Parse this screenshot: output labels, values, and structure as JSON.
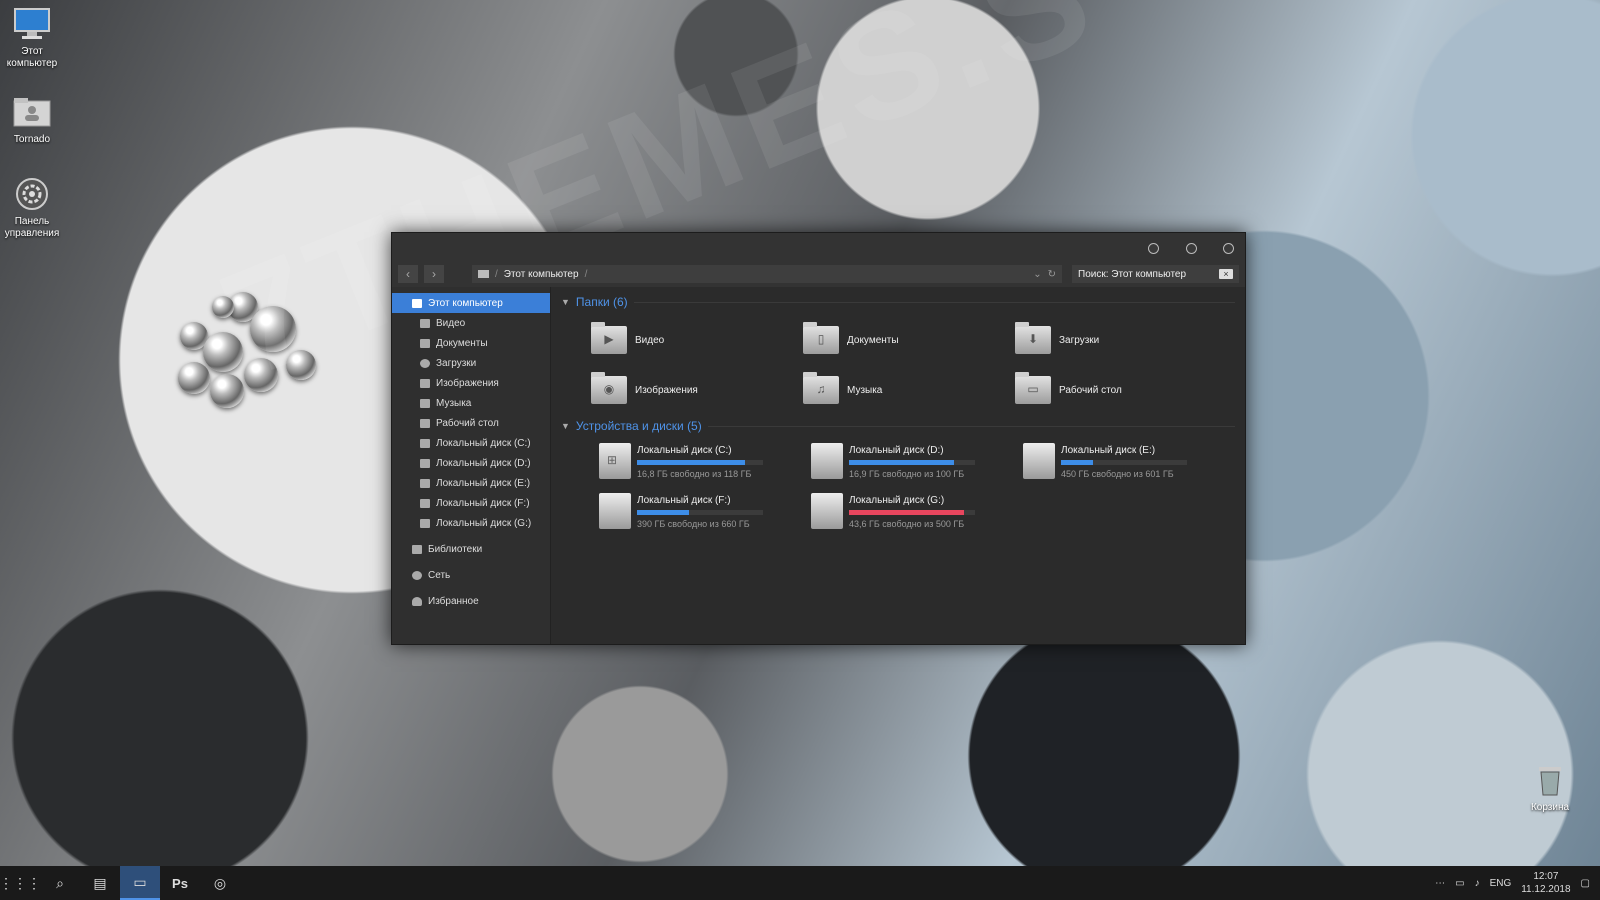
{
  "desktop": {
    "icons": [
      {
        "label": "Этот компьютер",
        "icon": "computer-icon"
      },
      {
        "label": "Tornado",
        "icon": "user-folder-icon"
      },
      {
        "label": "Панель управления",
        "icon": "control-panel-icon"
      },
      {
        "label": "Корзина",
        "icon": "recycle-bin-icon"
      }
    ],
    "watermark": "7THEMES.S"
  },
  "window": {
    "address": {
      "root": "Этот компьютер",
      "separator": "/"
    },
    "search_placeholder": "Поиск: Этот компьютер",
    "sidebar": {
      "root": "Этот компьютер",
      "items": [
        "Видео",
        "Документы",
        "Загрузки",
        "Изображения",
        "Музыка",
        "Рабочий стол",
        "Локальный диск (C:)",
        "Локальный диск (D:)",
        "Локальный диск (E:)",
        "Локальный диск (F:)",
        "Локальный диск (G:)"
      ],
      "groups": [
        "Библиотеки",
        "Сеть",
        "Избранное"
      ]
    },
    "folders_header": "Папки (6)",
    "folders": [
      {
        "name": "Видео",
        "icon": "video-icon"
      },
      {
        "name": "Документы",
        "icon": "documents-icon"
      },
      {
        "name": "Загрузки",
        "icon": "downloads-icon"
      },
      {
        "name": "Изображения",
        "icon": "camera-icon"
      },
      {
        "name": "Музыка",
        "icon": "music-icon"
      },
      {
        "name": "Рабочий стол",
        "icon": "desktop-icon"
      }
    ],
    "drives_header": "Устройства и диски (5)",
    "drives": [
      {
        "name": "Локальный диск (C:)",
        "free": "16,8 ГБ свободно из 118 ГБ",
        "used_fraction": 0.86,
        "color": "#3d8de8",
        "system": true
      },
      {
        "name": "Локальный диск (D:)",
        "free": "16,9 ГБ свободно из 100 ГБ",
        "used_fraction": 0.83,
        "color": "#3d8de8",
        "system": false
      },
      {
        "name": "Локальный диск (E:)",
        "free": "450 ГБ свободно из 601 ГБ",
        "used_fraction": 0.25,
        "color": "#3d8de8",
        "system": false
      },
      {
        "name": "Локальный диск (F:)",
        "free": "390 ГБ свободно из 660 ГБ",
        "used_fraction": 0.41,
        "color": "#3d8de8",
        "system": false
      },
      {
        "name": "Локальный диск (G:)",
        "free": "43,6 ГБ свободно из 500 ГБ",
        "used_fraction": 0.91,
        "color": "#e8465e",
        "system": false
      }
    ]
  },
  "taskbar": {
    "apps": [
      "start-icon",
      "search-icon",
      "task-view-icon",
      "explorer-icon",
      "photoshop-icon",
      "chrome-icon"
    ],
    "photoshop_label": "Ps",
    "tray": {
      "overflow": "⋯",
      "lang": "ENG",
      "time": "12:07",
      "date": "11.12.2018"
    }
  }
}
